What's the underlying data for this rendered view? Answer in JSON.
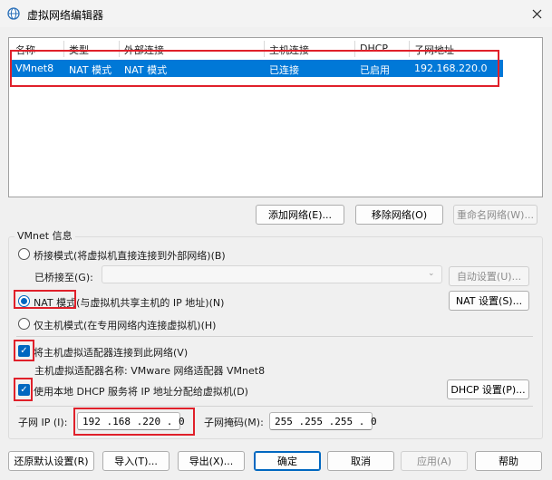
{
  "window": {
    "title": "虚拟网络编辑器"
  },
  "netlist": {
    "columns": [
      "名称",
      "类型",
      "外部连接",
      "主机连接",
      "DHCP",
      "子网地址"
    ],
    "rows": [
      {
        "name": "VMnet8",
        "type": "NAT 模式",
        "external": "NAT 模式",
        "host": "已连接",
        "dhcp": "已启用",
        "subnet": "192.168.220.0"
      }
    ]
  },
  "list_buttons": {
    "add": "添加网络(E)...",
    "remove": "移除网络(O)",
    "rename": "重命名网络(W)..."
  },
  "vmnet_info": {
    "title": "VMnet 信息",
    "bridged_label": "桥接模式(将虚拟机直接连接到外部网络)(B)",
    "bridged_to_label": "已桥接至(G):",
    "auto_settings": "自动设置(U)...",
    "nat_label": "NAT 模式(与虚拟机共享主机的 IP 地址)(N)",
    "nat_settings": "NAT 设置(S)...",
    "hostonly_label": "仅主机模式(在专用网络内连接虚拟机)(H)",
    "connect_adapter_label": "将主机虚拟适配器连接到此网络(V)",
    "adapter_name_text": "主机虚拟适配器名称: VMware 网络适配器 VMnet8",
    "dhcp_label": "使用本地 DHCP 服务将 IP 地址分配给虚拟机(D)",
    "dhcp_settings": "DHCP 设置(P)...",
    "subnet_ip_label": "子网 IP (I):",
    "subnet_ip_value": "192 .168 .220 . 0",
    "subnet_mask_label": "子网掩码(M):",
    "subnet_mask_value": "255 .255 .255 . 0"
  },
  "footer": {
    "restore": "还原默认设置(R)",
    "import": "导入(T)...",
    "export": "导出(X)...",
    "ok": "确定",
    "cancel": "取消",
    "apply": "应用(A)",
    "help": "帮助"
  },
  "colors": {
    "accent": "#0078d7",
    "highlight_box": "#e0202a"
  },
  "icons": {
    "app": "network-globe-icon",
    "close": "close-icon",
    "check": "check-icon",
    "dropdown": "chevron-down-icon"
  }
}
